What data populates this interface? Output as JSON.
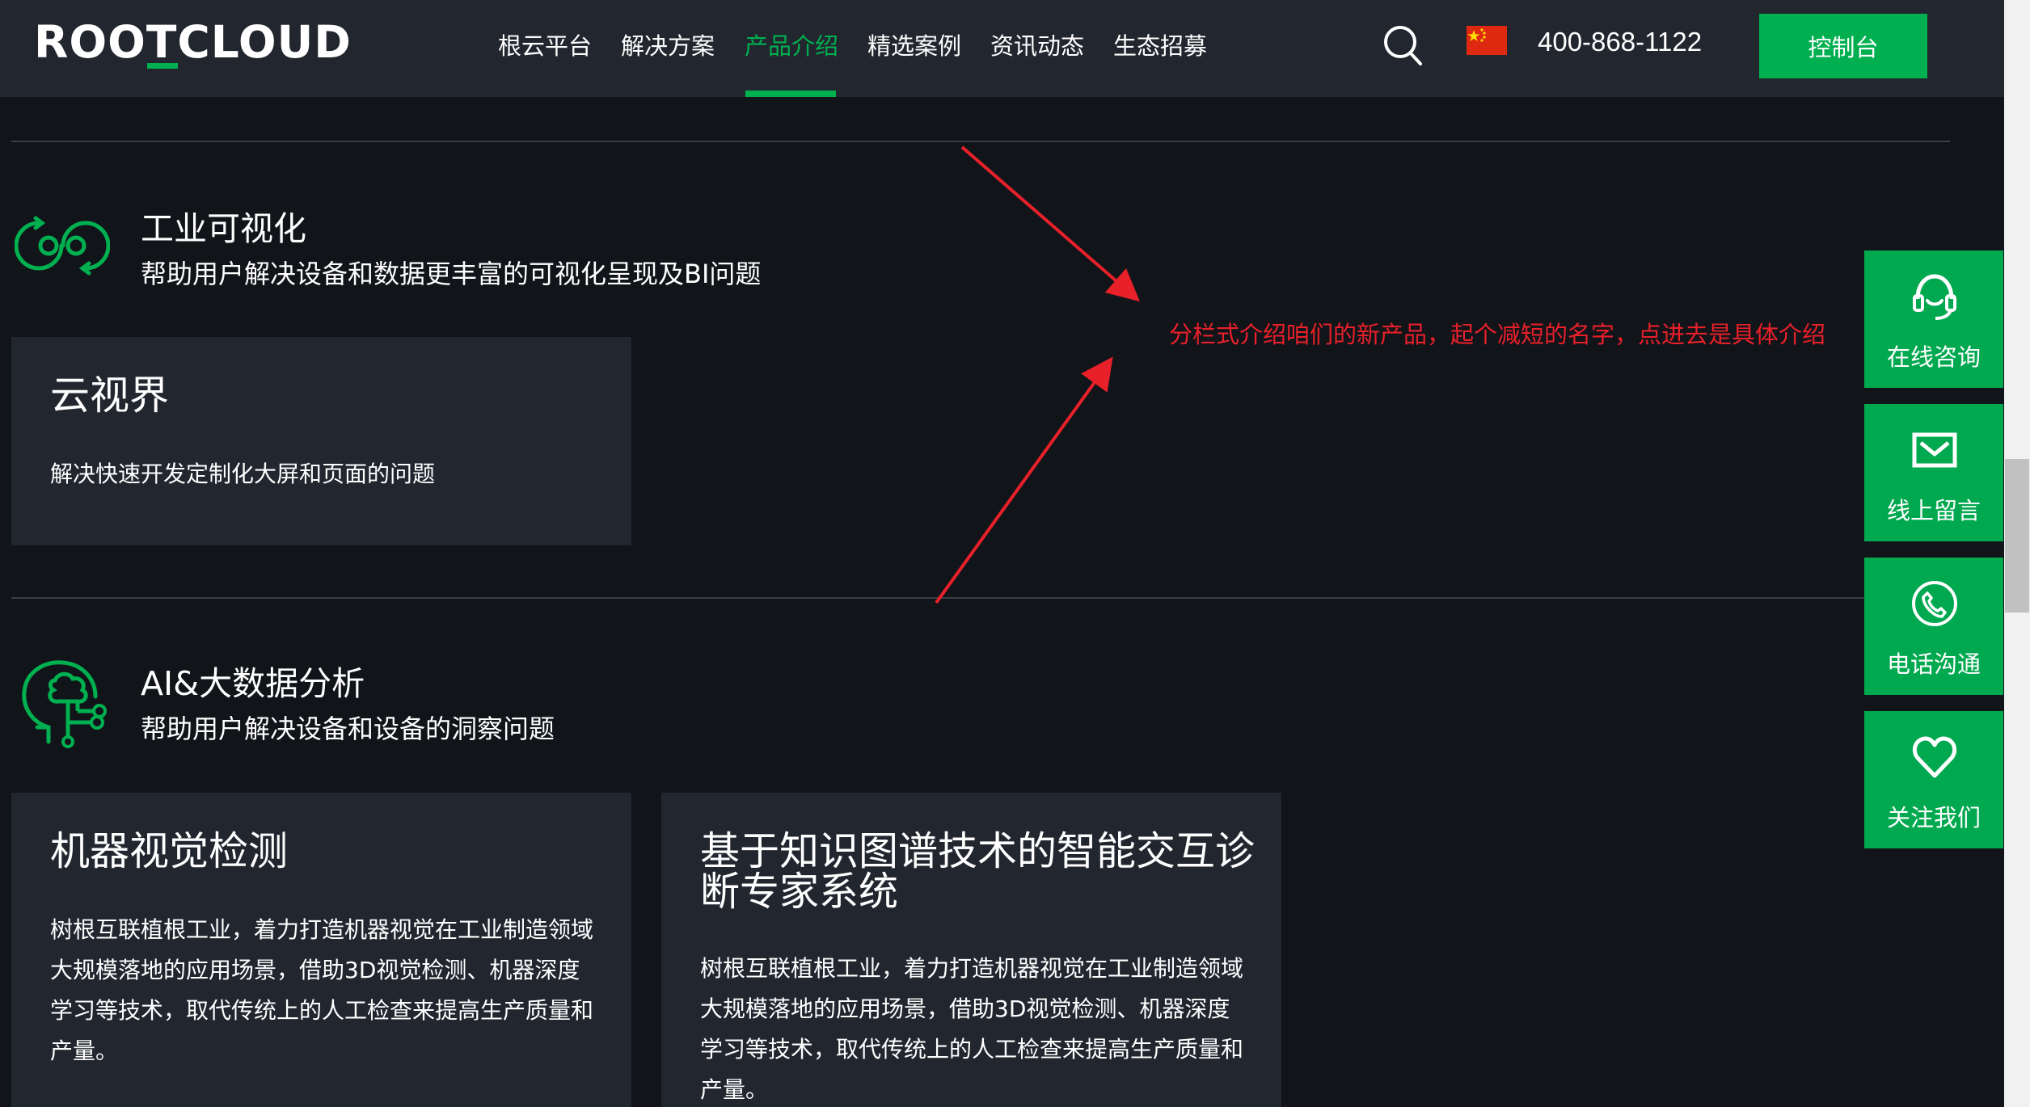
{
  "header": {
    "logo_text": "ROOTCLOUD",
    "nav": [
      {
        "label": "根云平台",
        "active": false
      },
      {
        "label": "解决方案",
        "active": false
      },
      {
        "label": "产品介绍",
        "active": true
      },
      {
        "label": "精选案例",
        "active": false
      },
      {
        "label": "资讯动态",
        "active": false
      },
      {
        "label": "生态招募",
        "active": false
      }
    ],
    "search_icon": "search-icon",
    "flag_icon": "china-flag-icon",
    "phone": "400-868-1122",
    "console_label": "控制台"
  },
  "sections": [
    {
      "icon": "infinity-link-icon",
      "title": "工业可视化",
      "description": "帮助用户解决设备和数据更丰富的可视化呈现及BI问题",
      "cards": [
        {
          "title": "云视界",
          "description": "解决快速开发定制化大屏和页面的问题"
        }
      ]
    },
    {
      "icon": "ai-head-circuit-icon",
      "title": "AI&大数据分析",
      "description": "帮助用户解决设备和设备的洞察问题",
      "cards": [
        {
          "title": "机器视觉检测",
          "description_lines": [
            "树根互联植根工业，着力打造机器视觉在工业制造领域",
            "大规模落地的应用场景，借助3D视觉检测、机器深度",
            "学习等技术，取代传统上的人工检查来提高生产质量和",
            "产量。"
          ]
        },
        {
          "title_lines": [
            "基于知识图谱技术的智能交互诊",
            "断专家系统"
          ],
          "description_lines": [
            "树根互联植根工业，着力打造机器视觉在工业制造领域",
            "大规模落地的应用场景，借助3D视觉检测、机器深度",
            "学习等技术，取代传统上的人工检查来提高生产质量和",
            "产量。"
          ]
        }
      ]
    }
  ],
  "annotation": {
    "text": "分栏式介绍咱们的新产品，起个减短的名字，点进去是具体介绍",
    "color": "#e8202a"
  },
  "side_panel": [
    {
      "icon": "headset-icon",
      "label": "在线咨询"
    },
    {
      "icon": "mail-icon",
      "label": "线上留言"
    },
    {
      "icon": "phone-icon",
      "label": "电话沟通"
    },
    {
      "icon": "heart-icon",
      "label": "关注我们"
    }
  ],
  "colors": {
    "accent": "#00b050",
    "background": "#111419",
    "header_bg": "#22262e",
    "card_bg": "#22262f"
  }
}
